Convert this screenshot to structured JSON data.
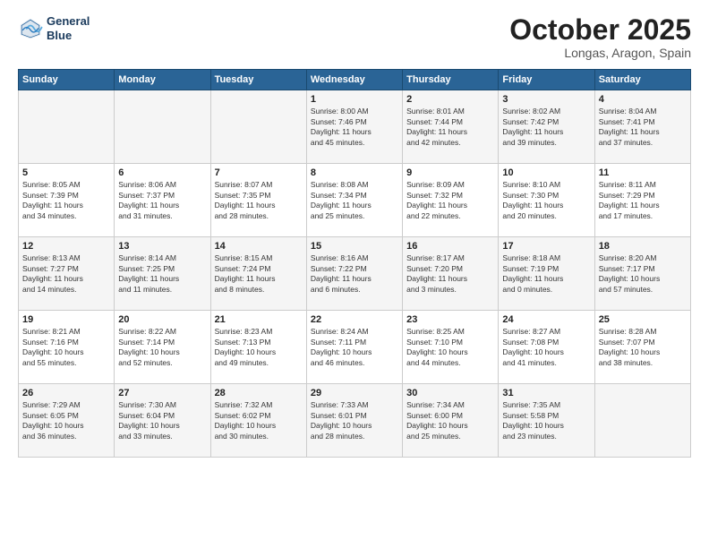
{
  "header": {
    "logo_line1": "General",
    "logo_line2": "Blue",
    "month": "October 2025",
    "location": "Longas, Aragon, Spain"
  },
  "weekdays": [
    "Sunday",
    "Monday",
    "Tuesday",
    "Wednesday",
    "Thursday",
    "Friday",
    "Saturday"
  ],
  "weeks": [
    [
      {
        "day": "",
        "info": ""
      },
      {
        "day": "",
        "info": ""
      },
      {
        "day": "",
        "info": ""
      },
      {
        "day": "1",
        "info": "Sunrise: 8:00 AM\nSunset: 7:46 PM\nDaylight: 11 hours\nand 45 minutes."
      },
      {
        "day": "2",
        "info": "Sunrise: 8:01 AM\nSunset: 7:44 PM\nDaylight: 11 hours\nand 42 minutes."
      },
      {
        "day": "3",
        "info": "Sunrise: 8:02 AM\nSunset: 7:42 PM\nDaylight: 11 hours\nand 39 minutes."
      },
      {
        "day": "4",
        "info": "Sunrise: 8:04 AM\nSunset: 7:41 PM\nDaylight: 11 hours\nand 37 minutes."
      }
    ],
    [
      {
        "day": "5",
        "info": "Sunrise: 8:05 AM\nSunset: 7:39 PM\nDaylight: 11 hours\nand 34 minutes."
      },
      {
        "day": "6",
        "info": "Sunrise: 8:06 AM\nSunset: 7:37 PM\nDaylight: 11 hours\nand 31 minutes."
      },
      {
        "day": "7",
        "info": "Sunrise: 8:07 AM\nSunset: 7:35 PM\nDaylight: 11 hours\nand 28 minutes."
      },
      {
        "day": "8",
        "info": "Sunrise: 8:08 AM\nSunset: 7:34 PM\nDaylight: 11 hours\nand 25 minutes."
      },
      {
        "day": "9",
        "info": "Sunrise: 8:09 AM\nSunset: 7:32 PM\nDaylight: 11 hours\nand 22 minutes."
      },
      {
        "day": "10",
        "info": "Sunrise: 8:10 AM\nSunset: 7:30 PM\nDaylight: 11 hours\nand 20 minutes."
      },
      {
        "day": "11",
        "info": "Sunrise: 8:11 AM\nSunset: 7:29 PM\nDaylight: 11 hours\nand 17 minutes."
      }
    ],
    [
      {
        "day": "12",
        "info": "Sunrise: 8:13 AM\nSunset: 7:27 PM\nDaylight: 11 hours\nand 14 minutes."
      },
      {
        "day": "13",
        "info": "Sunrise: 8:14 AM\nSunset: 7:25 PM\nDaylight: 11 hours\nand 11 minutes."
      },
      {
        "day": "14",
        "info": "Sunrise: 8:15 AM\nSunset: 7:24 PM\nDaylight: 11 hours\nand 8 minutes."
      },
      {
        "day": "15",
        "info": "Sunrise: 8:16 AM\nSunset: 7:22 PM\nDaylight: 11 hours\nand 6 minutes."
      },
      {
        "day": "16",
        "info": "Sunrise: 8:17 AM\nSunset: 7:20 PM\nDaylight: 11 hours\nand 3 minutes."
      },
      {
        "day": "17",
        "info": "Sunrise: 8:18 AM\nSunset: 7:19 PM\nDaylight: 11 hours\nand 0 minutes."
      },
      {
        "day": "18",
        "info": "Sunrise: 8:20 AM\nSunset: 7:17 PM\nDaylight: 10 hours\nand 57 minutes."
      }
    ],
    [
      {
        "day": "19",
        "info": "Sunrise: 8:21 AM\nSunset: 7:16 PM\nDaylight: 10 hours\nand 55 minutes."
      },
      {
        "day": "20",
        "info": "Sunrise: 8:22 AM\nSunset: 7:14 PM\nDaylight: 10 hours\nand 52 minutes."
      },
      {
        "day": "21",
        "info": "Sunrise: 8:23 AM\nSunset: 7:13 PM\nDaylight: 10 hours\nand 49 minutes."
      },
      {
        "day": "22",
        "info": "Sunrise: 8:24 AM\nSunset: 7:11 PM\nDaylight: 10 hours\nand 46 minutes."
      },
      {
        "day": "23",
        "info": "Sunrise: 8:25 AM\nSunset: 7:10 PM\nDaylight: 10 hours\nand 44 minutes."
      },
      {
        "day": "24",
        "info": "Sunrise: 8:27 AM\nSunset: 7:08 PM\nDaylight: 10 hours\nand 41 minutes."
      },
      {
        "day": "25",
        "info": "Sunrise: 8:28 AM\nSunset: 7:07 PM\nDaylight: 10 hours\nand 38 minutes."
      }
    ],
    [
      {
        "day": "26",
        "info": "Sunrise: 7:29 AM\nSunset: 6:05 PM\nDaylight: 10 hours\nand 36 minutes."
      },
      {
        "day": "27",
        "info": "Sunrise: 7:30 AM\nSunset: 6:04 PM\nDaylight: 10 hours\nand 33 minutes."
      },
      {
        "day": "28",
        "info": "Sunrise: 7:32 AM\nSunset: 6:02 PM\nDaylight: 10 hours\nand 30 minutes."
      },
      {
        "day": "29",
        "info": "Sunrise: 7:33 AM\nSunset: 6:01 PM\nDaylight: 10 hours\nand 28 minutes."
      },
      {
        "day": "30",
        "info": "Sunrise: 7:34 AM\nSunset: 6:00 PM\nDaylight: 10 hours\nand 25 minutes."
      },
      {
        "day": "31",
        "info": "Sunrise: 7:35 AM\nSunset: 5:58 PM\nDaylight: 10 hours\nand 23 minutes."
      },
      {
        "day": "",
        "info": ""
      }
    ]
  ]
}
